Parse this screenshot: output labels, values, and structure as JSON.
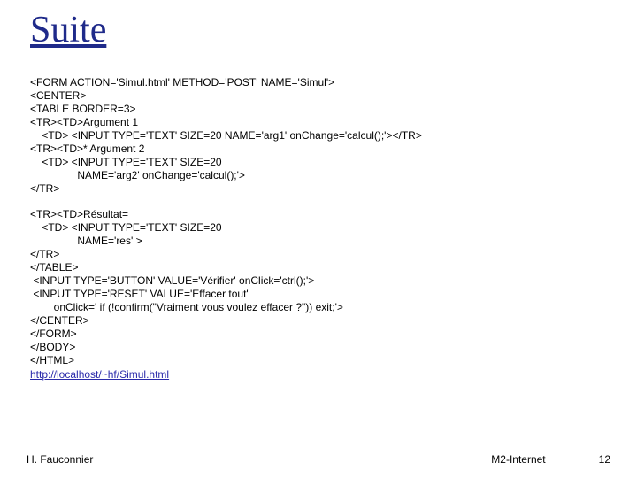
{
  "title": "Suite",
  "code_block_1": "<FORM ACTION='Simul.html' METHOD='POST' NAME='Simul'>\n<CENTER>\n<TABLE BORDER=3>\n<TR><TD>Argument 1\n    <TD> <INPUT TYPE='TEXT' SIZE=20 NAME='arg1' onChange='calcul();'></TR>\n<TR><TD>* Argument 2\n    <TD> <INPUT TYPE='TEXT' SIZE=20\n                NAME='arg2' onChange='calcul();'>\n</TR>",
  "code_block_2": "<TR><TD>Résultat=\n    <TD> <INPUT TYPE='TEXT' SIZE=20\n                NAME='res' >\n</TR>\n</TABLE>\n <INPUT TYPE='BUTTON' VALUE='Vérifier' onClick='ctrl();'>\n <INPUT TYPE='RESET' VALUE='Effacer tout'\n        onClick=' if (!confirm(\"Vraiment vous voulez effacer ?\")) exit;'>\n</CENTER>\n</FORM>\n</BODY>\n</HTML>",
  "link_text": "http://localhost/~hf/Simul.html",
  "footer": {
    "author": "H. Fauconnier",
    "course": "M2-Internet",
    "page": "12"
  }
}
